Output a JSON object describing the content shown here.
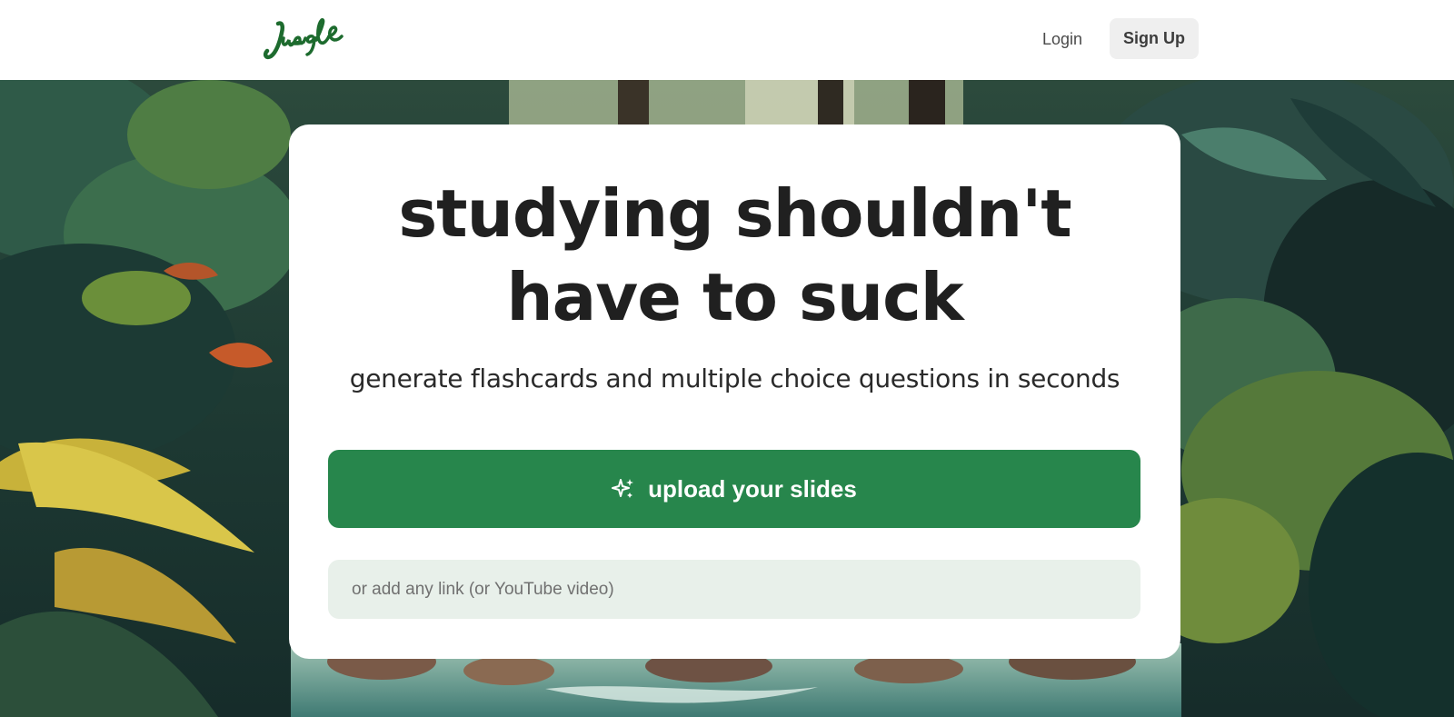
{
  "header": {
    "logo_text": "Jungle",
    "login_label": "Login",
    "signup_label": "Sign Up"
  },
  "hero": {
    "headline_line1": "studying shouldn't",
    "headline_line2": "have to suck",
    "subheadline": "generate flashcards and multiple choice questions in seconds",
    "upload_label": "upload your slides",
    "upload_icon": "sparkles-icon",
    "link_placeholder": "or add any link (or YouTube video)",
    "link_value": ""
  },
  "colors": {
    "brand_green": "#27864c",
    "logo_green": "#1d6b2e",
    "input_bg": "#e8f0ea",
    "signup_bg": "#efefef"
  }
}
